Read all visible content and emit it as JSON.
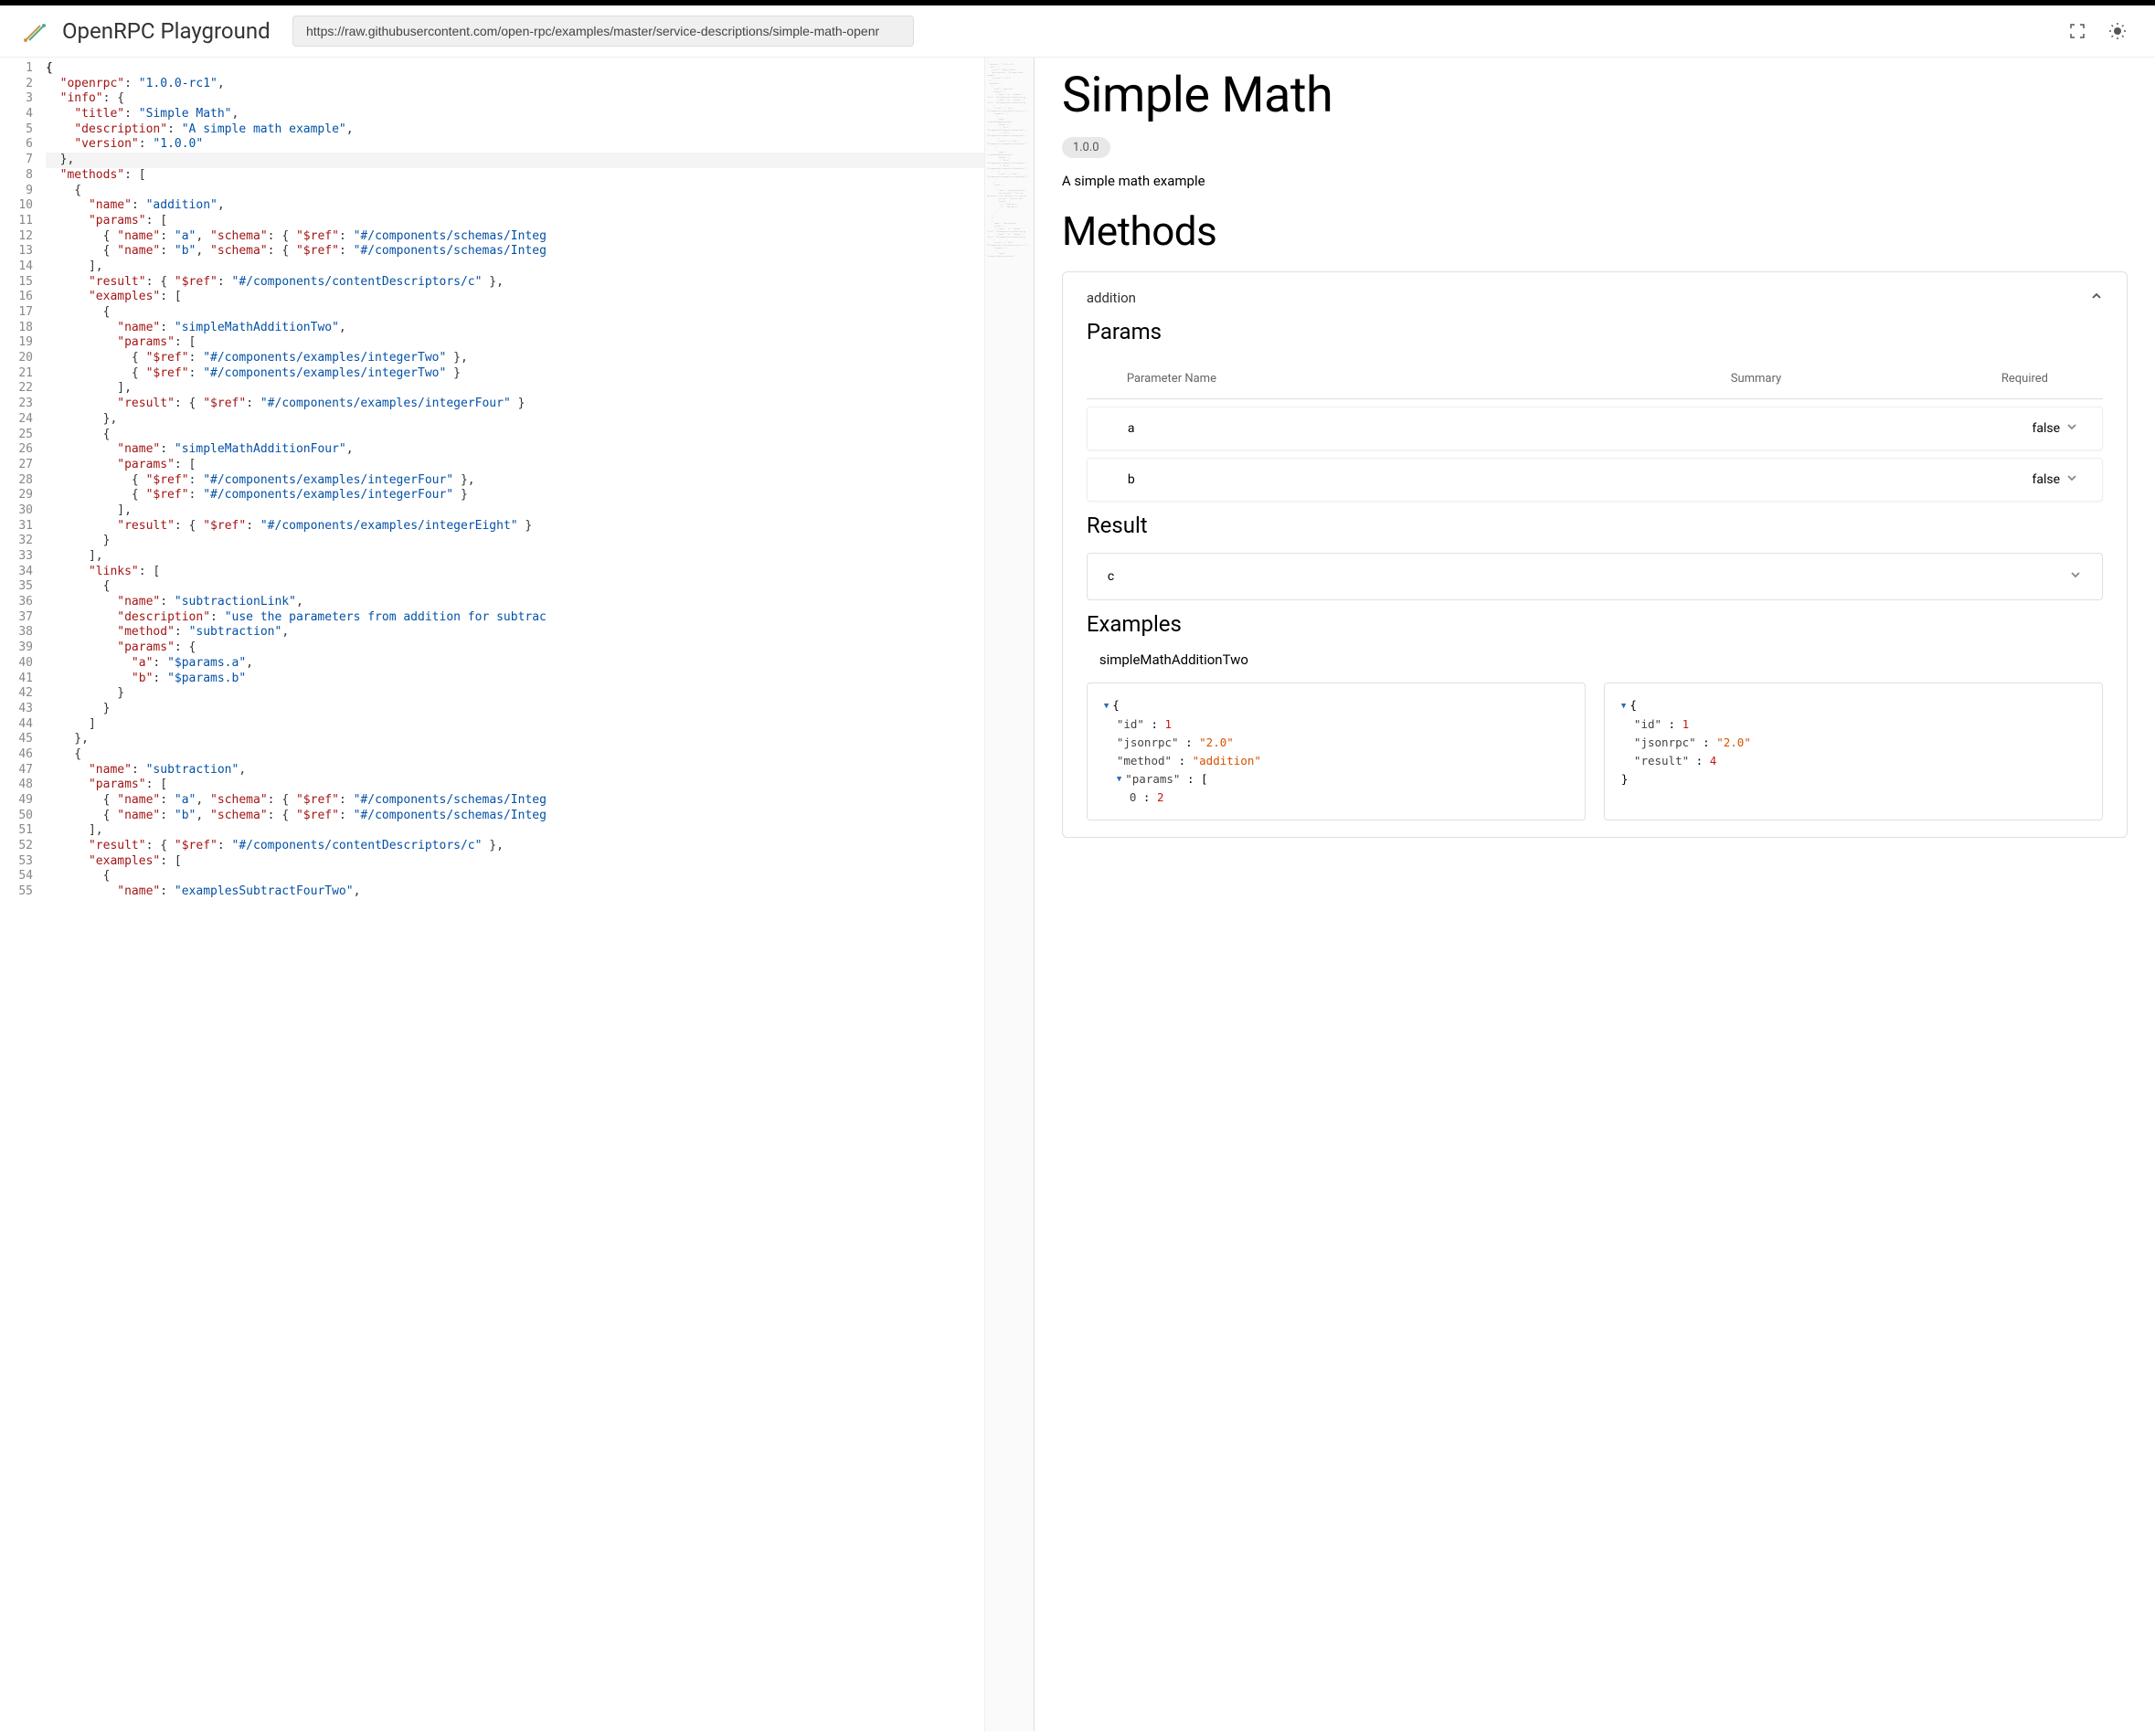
{
  "header": {
    "brand": "OpenRPC Playground",
    "url": "https://raw.githubusercontent.com/open-rpc/examples/master/service-descriptions/simple-math-openr"
  },
  "editor": {
    "lines": [
      {
        "n": 1,
        "html": "<span class='tok-brace'>{</span>"
      },
      {
        "n": 2,
        "html": "  <span class='tok-key'>\"openrpc\"</span>: <span class='tok-str'>\"1.0.0-rc1\"</span>,"
      },
      {
        "n": 3,
        "html": "  <span class='tok-key'>\"info\"</span>: {"
      },
      {
        "n": 4,
        "html": "    <span class='tok-key'>\"title\"</span>: <span class='tok-str'>\"Simple Math\"</span>,"
      },
      {
        "n": 5,
        "html": "    <span class='tok-key'>\"description\"</span>: <span class='tok-str'>\"A simple math example\"</span>,"
      },
      {
        "n": 6,
        "html": "    <span class='tok-key'>\"version\"</span>: <span class='tok-str'>\"1.0.0\"</span>"
      },
      {
        "n": 7,
        "html": "  },",
        "hl": true
      },
      {
        "n": 8,
        "html": "  <span class='tok-key'>\"methods\"</span>: ["
      },
      {
        "n": 9,
        "html": "    {"
      },
      {
        "n": 10,
        "html": "      <span class='tok-key'>\"name\"</span>: <span class='tok-str'>\"addition\"</span>,"
      },
      {
        "n": 11,
        "html": "      <span class='tok-key'>\"params\"</span>: ["
      },
      {
        "n": 12,
        "html": "        { <span class='tok-key'>\"name\"</span>: <span class='tok-str'>\"a\"</span>, <span class='tok-key'>\"schema\"</span>: { <span class='tok-key'>\"$ref\"</span>: <span class='tok-str'>\"#/components/schemas/Integ</span>"
      },
      {
        "n": 13,
        "html": "        { <span class='tok-key'>\"name\"</span>: <span class='tok-str'>\"b\"</span>, <span class='tok-key'>\"schema\"</span>: { <span class='tok-key'>\"$ref\"</span>: <span class='tok-str'>\"#/components/schemas/Integ</span>"
      },
      {
        "n": 14,
        "html": "      ],"
      },
      {
        "n": 15,
        "html": "      <span class='tok-key'>\"result\"</span>: { <span class='tok-key'>\"$ref\"</span>: <span class='tok-str'>\"#/components/contentDescriptors/c\"</span> },"
      },
      {
        "n": 16,
        "html": "      <span class='tok-key'>\"examples\"</span>: ["
      },
      {
        "n": 17,
        "html": "        {"
      },
      {
        "n": 18,
        "html": "          <span class='tok-key'>\"name\"</span>: <span class='tok-str'>\"simpleMathAdditionTwo\"</span>,"
      },
      {
        "n": 19,
        "html": "          <span class='tok-key'>\"params\"</span>: ["
      },
      {
        "n": 20,
        "html": "            { <span class='tok-key'>\"$ref\"</span>: <span class='tok-str'>\"#/components/examples/integerTwo\"</span> },"
      },
      {
        "n": 21,
        "html": "            { <span class='tok-key'>\"$ref\"</span>: <span class='tok-str'>\"#/components/examples/integerTwo\"</span> }"
      },
      {
        "n": 22,
        "html": "          ],"
      },
      {
        "n": 23,
        "html": "          <span class='tok-key'>\"result\"</span>: { <span class='tok-key'>\"$ref\"</span>: <span class='tok-str'>\"#/components/examples/integerFour\"</span> }"
      },
      {
        "n": 24,
        "html": "        },"
      },
      {
        "n": 25,
        "html": "        {"
      },
      {
        "n": 26,
        "html": "          <span class='tok-key'>\"name\"</span>: <span class='tok-str'>\"simpleMathAdditionFour\"</span>,"
      },
      {
        "n": 27,
        "html": "          <span class='tok-key'>\"params\"</span>: ["
      },
      {
        "n": 28,
        "html": "            { <span class='tok-key'>\"$ref\"</span>: <span class='tok-str'>\"#/components/examples/integerFour\"</span> },"
      },
      {
        "n": 29,
        "html": "            { <span class='tok-key'>\"$ref\"</span>: <span class='tok-str'>\"#/components/examples/integerFour\"</span> }"
      },
      {
        "n": 30,
        "html": "          ],"
      },
      {
        "n": 31,
        "html": "          <span class='tok-key'>\"result\"</span>: { <span class='tok-key'>\"$ref\"</span>: <span class='tok-str'>\"#/components/examples/integerEight\"</span> }"
      },
      {
        "n": 32,
        "html": "        }"
      },
      {
        "n": 33,
        "html": "      ],"
      },
      {
        "n": 34,
        "html": "      <span class='tok-key'>\"links\"</span>: ["
      },
      {
        "n": 35,
        "html": "        {"
      },
      {
        "n": 36,
        "html": "          <span class='tok-key'>\"name\"</span>: <span class='tok-str'>\"subtractionLink\"</span>,"
      },
      {
        "n": 37,
        "html": "          <span class='tok-key'>\"description\"</span>: <span class='tok-str'>\"use the parameters from addition for subtrac</span>"
      },
      {
        "n": 38,
        "html": "          <span class='tok-key'>\"method\"</span>: <span class='tok-str'>\"subtraction\"</span>,"
      },
      {
        "n": 39,
        "html": "          <span class='tok-key'>\"params\"</span>: {"
      },
      {
        "n": 40,
        "html": "            <span class='tok-key'>\"a\"</span>: <span class='tok-str'>\"$params.a\"</span>,"
      },
      {
        "n": 41,
        "html": "            <span class='tok-key'>\"b\"</span>: <span class='tok-str'>\"$params.b\"</span>"
      },
      {
        "n": 42,
        "html": "          }"
      },
      {
        "n": 43,
        "html": "        }"
      },
      {
        "n": 44,
        "html": "      ]"
      },
      {
        "n": 45,
        "html": "    },"
      },
      {
        "n": 46,
        "html": "    {"
      },
      {
        "n": 47,
        "html": "      <span class='tok-key'>\"name\"</span>: <span class='tok-str'>\"subtraction\"</span>,"
      },
      {
        "n": 48,
        "html": "      <span class='tok-key'>\"params\"</span>: ["
      },
      {
        "n": 49,
        "html": "        { <span class='tok-key'>\"name\"</span>: <span class='tok-str'>\"a\"</span>, <span class='tok-key'>\"schema\"</span>: { <span class='tok-key'>\"$ref\"</span>: <span class='tok-str'>\"#/components/schemas/Integ</span>"
      },
      {
        "n": 50,
        "html": "        { <span class='tok-key'>\"name\"</span>: <span class='tok-str'>\"b\"</span>, <span class='tok-key'>\"schema\"</span>: { <span class='tok-key'>\"$ref\"</span>: <span class='tok-str'>\"#/components/schemas/Integ</span>"
      },
      {
        "n": 51,
        "html": "      ],"
      },
      {
        "n": 52,
        "html": "      <span class='tok-key'>\"result\"</span>: { <span class='tok-key'>\"$ref\"</span>: <span class='tok-str'>\"#/components/contentDescriptors/c\"</span> },"
      },
      {
        "n": 53,
        "html": "      <span class='tok-key'>\"examples\"</span>: ["
      },
      {
        "n": 54,
        "html": "        {"
      },
      {
        "n": 55,
        "html": "          <span class='tok-key'>\"name\"</span>: <span class='tok-str'>\"examplesSubtractFourTwo\"</span>,"
      }
    ]
  },
  "doc": {
    "title": "Simple Math",
    "version": "1.0.0",
    "description": "A simple math example",
    "methods_heading": "Methods",
    "method": {
      "name": "addition",
      "params_heading": "Params",
      "table_headers": {
        "name": "Parameter Name",
        "summary": "Summary",
        "required": "Required"
      },
      "params": [
        {
          "name": "a",
          "required": "false"
        },
        {
          "name": "b",
          "required": "false"
        }
      ],
      "result_heading": "Result",
      "result_name": "c",
      "examples_heading": "Examples",
      "example_name": "simpleMathAdditionTwo",
      "request": {
        "id_key": "\"id\"",
        "id_val": "1",
        "jsonrpc_key": "\"jsonrpc\"",
        "jsonrpc_val": "\"2.0\"",
        "method_key": "\"method\"",
        "method_val": "\"addition\"",
        "params_key": "\"params\"",
        "params_open": "[",
        "p0_key": "0",
        "p0_val": "2"
      },
      "response": {
        "id_key": "\"id\"",
        "id_val": "1",
        "jsonrpc_key": "\"jsonrpc\"",
        "jsonrpc_val": "\"2.0\"",
        "result_key": "\"result\"",
        "result_val": "4"
      }
    }
  }
}
